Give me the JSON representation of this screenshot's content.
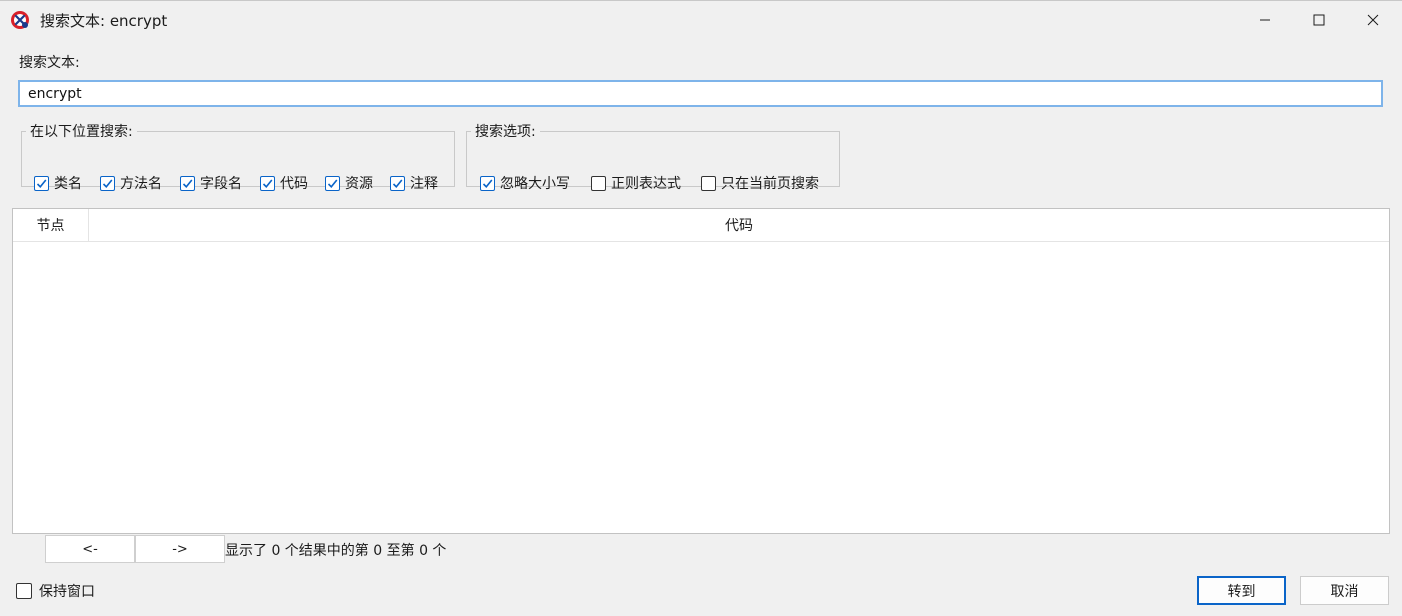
{
  "window": {
    "title": "搜索文本: encrypt",
    "icon": "jadx-app-icon",
    "controls": [
      "minimize-icon",
      "maximize-icon",
      "close-icon"
    ]
  },
  "search": {
    "label": "搜索文本:",
    "value": "encrypt"
  },
  "search_in": {
    "legend": "在以下位置搜索:",
    "options": [
      {
        "label": "类名",
        "checked": true
      },
      {
        "label": "方法名",
        "checked": true
      },
      {
        "label": "字段名",
        "checked": true
      },
      {
        "label": "代码",
        "checked": true
      },
      {
        "label": "资源",
        "checked": true
      },
      {
        "label": "注释",
        "checked": true
      }
    ]
  },
  "search_options": {
    "legend": "搜索选项:",
    "options": [
      {
        "label": "忽略大小写",
        "checked": true
      },
      {
        "label": "正则表达式",
        "checked": false
      },
      {
        "label": "只在当前页搜索",
        "checked": false
      }
    ]
  },
  "results": {
    "columns": [
      "节点",
      "代码"
    ],
    "rows": []
  },
  "pagination": {
    "prev_label": "<-",
    "next_label": "->",
    "status": "显示了 0 个结果中的第 0 至第 0 个"
  },
  "footer": {
    "keep_window_label": "保持窗口",
    "keep_window_checked": false,
    "goto_label": "转到",
    "cancel_label": "取消"
  }
}
